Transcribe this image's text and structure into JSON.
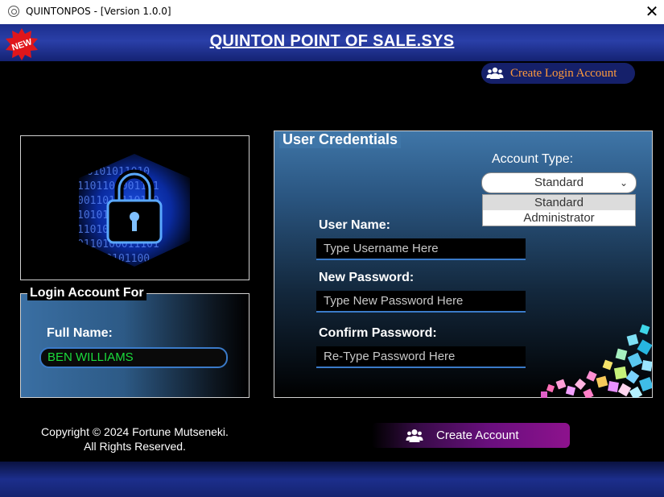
{
  "window": {
    "title": "QUINTONPOS - [Version 1.0.0]",
    "close_symbol": "✕"
  },
  "header": {
    "title": "QUINTON POINT OF SALE.SYS",
    "badge": "NEW"
  },
  "create_login": {
    "label": "Create Login Account"
  },
  "login_for": {
    "legend": "Login Account For",
    "full_name_label": "Full Name:",
    "full_name_value": "BEN WILLIAMS"
  },
  "credentials": {
    "legend": "User Credentials",
    "account_type_label": "Account Type:",
    "account_type_selected": "Standard",
    "account_type_options": [
      "Standard",
      "Administrator"
    ],
    "username_label": "User Name:",
    "username_placeholder": "Type Username Here",
    "new_password_label": "New Password:",
    "new_password_placeholder": "Type New Password Here",
    "confirm_password_label": "Confirm Password:",
    "confirm_password_placeholder": "Re-Type Password Here"
  },
  "footer": {
    "copyright_line1": "Copyright © 2024 Fortune Mutseneki.",
    "copyright_line2": "All Rights Reserved.",
    "create_account_label": "Create Account"
  },
  "colors": {
    "header_blue": "#1c2e8c",
    "accent_orange": "#ff9a3c",
    "name_green": "#1bdc3c",
    "button_purple": "#8d128d"
  },
  "icons": [
    "app-icon",
    "close-icon",
    "new-badge-icon",
    "users-icon",
    "padlock-icon",
    "chevron-down-icon"
  ]
}
